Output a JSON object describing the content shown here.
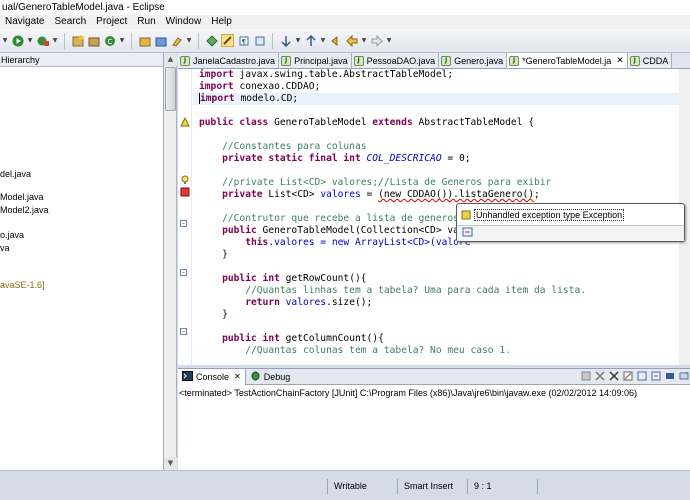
{
  "window": {
    "title": "ual/GeneroTableModel.java - Eclipse"
  },
  "menu": {
    "items": [
      "Navigate",
      "Search",
      "Project",
      "Run",
      "Window",
      "Help"
    ]
  },
  "left_panel": {
    "tab_label": "Hierarchy",
    "items": [
      "del.java",
      "Model.java",
      "Model2.java",
      "o.java",
      "va",
      "avaSE-1.6]"
    ]
  },
  "editor_tabs": [
    {
      "label": "JanelaCadastro.java",
      "active": false
    },
    {
      "label": "Principal.java",
      "active": false
    },
    {
      "label": "PessoaDAO.java",
      "active": false
    },
    {
      "label": "Genero.java",
      "active": false
    },
    {
      "label": "*GeneroTableModel.ja",
      "active": true
    },
    {
      "label": "CDDA",
      "active": false
    }
  ],
  "code": {
    "imports": [
      "javax.swing.table.AbstractTableModel",
      "conexao.CDDAO",
      "modelo.CD"
    ],
    "class_name": "GeneroTableModel",
    "superclass": "AbstractTableModel",
    "comment_constants": "//Constantes para colunas",
    "const_name": "COL_DESCRICAO",
    "const_value": "0",
    "comment_private": "//private List<CD> valores;//Lista de Generos para exibir",
    "field_type": "List<CD>",
    "field_name": "valores",
    "field_init_error": "(new CDDAO()).listaGenero()",
    "comment_ctor": "//Contrutor que recebe a lista de generos",
    "ctor_sig": "GeneroTableModel(Collection<CD> valo",
    "ctor_body": ".valores = new ArrayList<CD>(valore",
    "method_rowcount": "getRowCount",
    "comment_rowcount": "//Quantas linhas tem a tabela? Uma para cada item da lista.",
    "return_rowcount": "valores",
    "return_rowcount_call": ".size();",
    "method_colcount": "getColumnCount",
    "comment_colcount": "//Quantas colunas tem a tabela? No meu caso 1."
  },
  "quick_fix": {
    "message": "Unhandled exception type Exception"
  },
  "console": {
    "tabs": [
      "Console",
      "Debug"
    ],
    "status_text": "<terminated> TestActionChainFactory [JUnit] C:\\Program Files (x86)\\Java\\jre6\\bin\\javaw.exe (02/02/2012 14:09:06)"
  },
  "statusbar": {
    "mode": "Writable",
    "insert_mode": "Smart Insert",
    "position": "9 : 1"
  },
  "colors": {
    "keyword": "#7f0055",
    "comment": "#3f7f5f",
    "field": "#0000c0",
    "selection_line": "#e8f2fe"
  }
}
